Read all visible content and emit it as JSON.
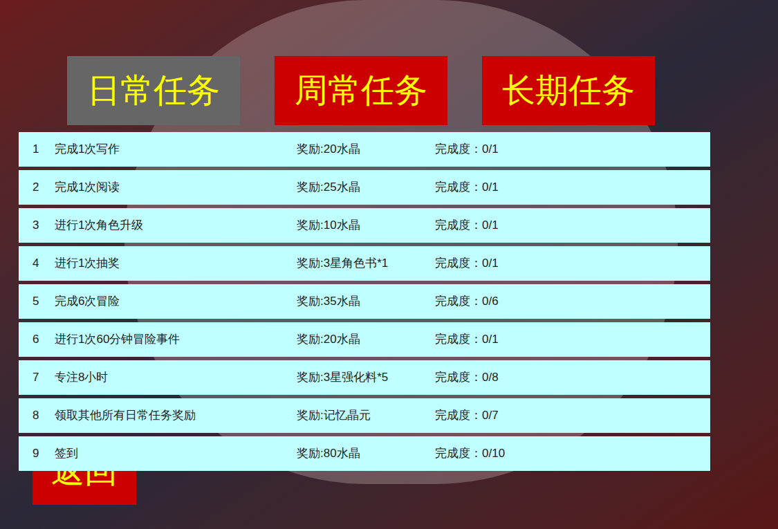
{
  "tabs": [
    {
      "label": "日常任务",
      "selected": true
    },
    {
      "label": "周常任务",
      "selected": false
    },
    {
      "label": "长期任务",
      "selected": false
    }
  ],
  "tasks": [
    {
      "index": "1",
      "name": "完成1次写作",
      "reward": "奖励:20水晶",
      "progress": "完成度：0/1"
    },
    {
      "index": "2",
      "name": "完成1次阅读",
      "reward": "奖励:25水晶",
      "progress": "完成度：0/1"
    },
    {
      "index": "3",
      "name": "进行1次角色升级",
      "reward": "奖励:10水晶",
      "progress": "完成度：0/1"
    },
    {
      "index": "4",
      "name": "进行1次抽奖",
      "reward": "奖励:3星角色书*1",
      "progress": "完成度：0/1"
    },
    {
      "index": "5",
      "name": "完成6次冒险",
      "reward": "奖励:35水晶",
      "progress": "完成度：0/6"
    },
    {
      "index": "6",
      "name": "进行1次60分钟冒险事件",
      "reward": "奖励:20水晶",
      "progress": "完成度：0/1"
    },
    {
      "index": "7",
      "name": "专注8小时",
      "reward": "奖励:3星强化料*5",
      "progress": "完成度：0/8"
    },
    {
      "index": "8",
      "name": "领取其他所有日常任务奖励",
      "reward": "奖励:记忆晶元",
      "progress": "完成度：0/7"
    },
    {
      "index": "9",
      "name": "签到",
      "reward": "奖励:80水晶",
      "progress": "完成度：0/10"
    }
  ],
  "back_button": "返回"
}
